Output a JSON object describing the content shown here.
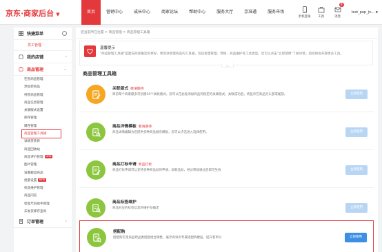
{
  "header": {
    "logo_text": "京东·商家后台",
    "logo_caret": "▼",
    "nav": [
      "首页",
      "营销中心",
      "成长中心",
      "商家论坛",
      "帮助中心",
      "服务大厅",
      "京准通",
      "服务市场"
    ],
    "tools": [
      {
        "icon": "mobile-icon",
        "label": "手机登录"
      },
      {
        "icon": "toolbox-icon",
        "label": "工具"
      },
      {
        "icon": "message-icon",
        "label": "消息",
        "badge": "9"
      }
    ],
    "user_name": "test_pop_jn...",
    "user_caret": "▼"
  },
  "sidebar": {
    "quick_menu": "快捷菜单",
    "quick_items": [
      "员工管理"
    ],
    "shop_group": "我的店铺",
    "goods_group": "商品管理",
    "goods_items": [
      {
        "label": "在售商品管理",
        "new": false
      },
      {
        "label": "添加新商品",
        "new": false
      },
      {
        "label": "待售商品管理",
        "new": false
      },
      {
        "label": "商品信息管理",
        "new": false
      },
      {
        "label": "关联版式设置",
        "new": false
      },
      {
        "label": "库存管理",
        "new": false
      },
      {
        "label": "属性管理",
        "new": false
      },
      {
        "label": "商品管理工具箱",
        "new": false,
        "active": true
      },
      {
        "label": "详情页装修",
        "new": false
      },
      {
        "label": "商品回收站",
        "new": false
      },
      {
        "label": "商品评价管理",
        "new": true
      },
      {
        "label": "图片管理",
        "new": false
      },
      {
        "label": "设置搬运商品",
        "new": false
      },
      {
        "label": "批量设置",
        "new": true
      },
      {
        "label": "标品维护管理",
        "new": false
      },
      {
        "label": "商品问答",
        "new": false
      },
      {
        "label": "智能尺码助手管理",
        "new": false
      },
      {
        "label": "未发货库存查询",
        "new": false
      }
    ],
    "order_group": "订单管理",
    "new_tag": "NEW"
  },
  "breadcrumb": "您当前所在位置 > 商品管理 > 商品管理工具箱",
  "tip": {
    "title": "温馨提示",
    "text": "\"商品管理工具箱\"是面向商家推出的更好、更高效管理商品的工具箱，包括批量管理、营销、商品维护等工具类型。您可以点击\"立即使用\"了解详情，后续将会开放更多工具。",
    "collapse": "︿"
  },
  "section_title": "商品管理工具箱",
  "button_label": "立即使用",
  "cards": [
    {
      "title": "关联版式",
      "tag": "敬请期待",
      "desc": "目前每个商家最多可创建50个关联版式，您可以在此处添加商品到指定的关联版式，关联成功后，将显示在商品页头部或尾部。",
      "icon": "edit-icon",
      "color": "#f5a623",
      "enabled": false
    },
    {
      "title": "商品详情模板",
      "tag": "敬请期待",
      "desc": "商品详情编辑为您提供多种商品展示模板，您可以点击进入选择使用。",
      "icon": "document-search-icon",
      "color": "#8cc63f",
      "enabled": false
    },
    {
      "title": "商品打标申请",
      "tag": "新品打标",
      "desc": "商品打标申请可以支持多种商品标的申请，如新品标，经过审核通过后即可生效",
      "icon": "edit-icon",
      "color": "#8cc63f",
      "enabled": false
    },
    {
      "title": "商品标签维护",
      "tag": "",
      "desc": "商品对应的标签信息的维护与确定",
      "icon": "document-search-icon",
      "color": "#8cc63f",
      "enabled": false
    },
    {
      "title": "搭配购",
      "tag": "",
      "desc": "搭配购实现商品跨品类搭配组合销售，展示商详页专属搭配购楼层，提升客单价",
      "icon": "document-search-icon",
      "color": "#8cc63f",
      "enabled": true,
      "highlight": true
    }
  ]
}
